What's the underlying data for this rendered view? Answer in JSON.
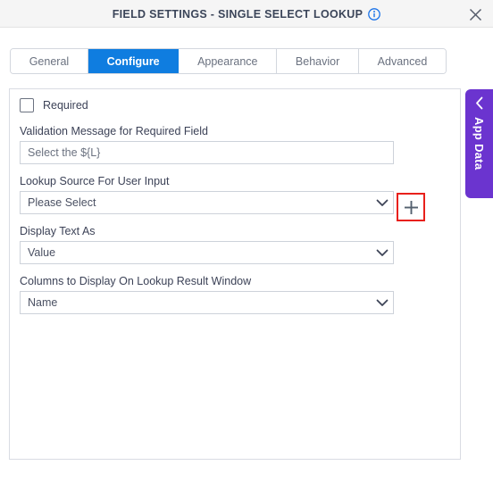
{
  "window": {
    "title": "FIELD SETTINGS - SINGLE SELECT LOOKUP",
    "info_icon": "info-circle-icon",
    "close_icon": "close-icon",
    "header_bg": "#f5f5f5",
    "title_color": "#3b4559"
  },
  "tabs": {
    "active_color": "#0f7de0",
    "items": [
      {
        "label": "General",
        "active": false
      },
      {
        "label": "Configure",
        "active": true
      },
      {
        "label": "Appearance",
        "active": false
      },
      {
        "label": "Behavior",
        "active": false
      },
      {
        "label": "Advanced",
        "active": false
      }
    ]
  },
  "form": {
    "required": {
      "label": "Required",
      "checked": false
    },
    "validation_message": {
      "label": "Validation Message for Required Field",
      "value": "Select the ${L}",
      "placeholder": "Select the ${L}"
    },
    "lookup_source": {
      "label": "Lookup Source For User Input",
      "value": "Please Select",
      "chevron_icon": "chevron-down-icon"
    },
    "add_lookup_source": {
      "icon": "plus-icon",
      "highlight_color": "#e8201b"
    },
    "display_text_as": {
      "label": "Display Text As",
      "value": "Value",
      "chevron_icon": "chevron-down-icon"
    },
    "columns_to_display": {
      "label": "Columns to Display On Lookup Result Window",
      "value": "Name",
      "chevron_icon": "chevron-down-icon"
    }
  },
  "app_data_panel": {
    "label": "App Data",
    "collapse_icon": "chevron-left-icon",
    "color": "#6b34cf"
  }
}
